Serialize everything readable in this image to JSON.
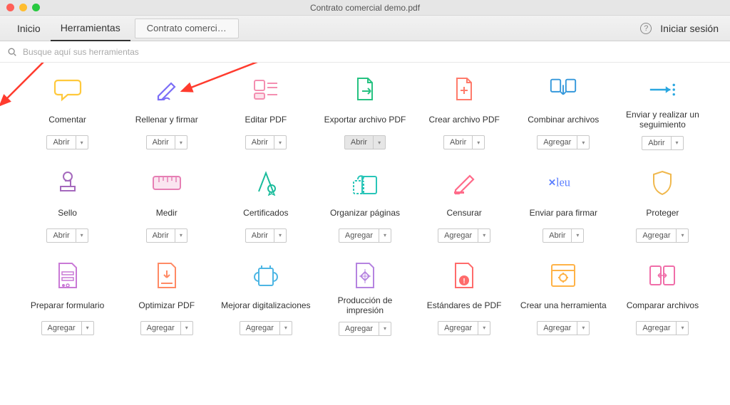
{
  "window": {
    "title": "Contrato comercial demo.pdf"
  },
  "tabs": {
    "home": "Inicio",
    "tools": "Herramientas",
    "document": "Contrato comerci…"
  },
  "header": {
    "signin": "Iniciar sesión"
  },
  "search": {
    "placeholder": "Busque aquí sus herramientas"
  },
  "actions": {
    "open": "Abrir",
    "add": "Agregar"
  },
  "tools": [
    {
      "id": "comment",
      "label": "Comentar",
      "action": "open",
      "icon": "comment",
      "color": "#ffc93c"
    },
    {
      "id": "fill-sign",
      "label": "Rellenar y firmar",
      "action": "open",
      "icon": "fill-sign",
      "color": "#7b6ef6"
    },
    {
      "id": "edit-pdf",
      "label": "Editar PDF",
      "action": "open",
      "icon": "edit-pdf",
      "color": "#f48fb1"
    },
    {
      "id": "export-pdf",
      "label": "Exportar archivo PDF",
      "action": "open",
      "icon": "export",
      "color": "#26c281",
      "highlight": true
    },
    {
      "id": "create-pdf",
      "label": "Crear archivo PDF",
      "action": "open",
      "icon": "create",
      "color": "#ff7b6b"
    },
    {
      "id": "combine",
      "label": "Combinar archivos",
      "action": "add",
      "icon": "combine",
      "color": "#3498db"
    },
    {
      "id": "send-track",
      "label": "Enviar y realizar un seguimiento",
      "action": "open",
      "icon": "send-track",
      "color": "#2aa7e0"
    },
    {
      "id": "stamp",
      "label": "Sello",
      "action": "open",
      "icon": "stamp",
      "color": "#a569bd"
    },
    {
      "id": "measure",
      "label": "Medir",
      "action": "open",
      "icon": "measure",
      "color": "#e67fb4"
    },
    {
      "id": "certificates",
      "label": "Certificados",
      "action": "open",
      "icon": "certificate",
      "color": "#1abc9c"
    },
    {
      "id": "organize",
      "label": "Organizar páginas",
      "action": "add",
      "icon": "organize",
      "color": "#29c5b8"
    },
    {
      "id": "redact",
      "label": "Censurar",
      "action": "add",
      "icon": "redact",
      "color": "#ff6b8a"
    },
    {
      "id": "send-sign",
      "label": "Enviar para firmar",
      "action": "open",
      "icon": "send-sign",
      "color": "#5b7fff"
    },
    {
      "id": "protect",
      "label": "Proteger",
      "action": "add",
      "icon": "protect",
      "color": "#f0b84d"
    },
    {
      "id": "prepare-form",
      "label": "Preparar formulario",
      "action": "add",
      "icon": "prepare-form",
      "color": "#c979d6"
    },
    {
      "id": "optimize",
      "label": "Optimizar PDF",
      "action": "add",
      "icon": "optimize",
      "color": "#ff8a65"
    },
    {
      "id": "enhance-scans",
      "label": "Mejorar digitalizaciones",
      "action": "add",
      "icon": "enhance",
      "color": "#4db6e4"
    },
    {
      "id": "print-prod",
      "label": "Producción de impresión",
      "action": "add",
      "icon": "print-prod",
      "color": "#b583e0"
    },
    {
      "id": "standards",
      "label": "Estándares de PDF",
      "action": "add",
      "icon": "standards",
      "color": "#ff6b6b"
    },
    {
      "id": "create-tool",
      "label": "Crear una herramienta",
      "action": "add",
      "icon": "create-tool",
      "color": "#ffb347"
    },
    {
      "id": "compare",
      "label": "Comparar archivos",
      "action": "add",
      "icon": "compare",
      "color": "#f06ea9"
    }
  ]
}
